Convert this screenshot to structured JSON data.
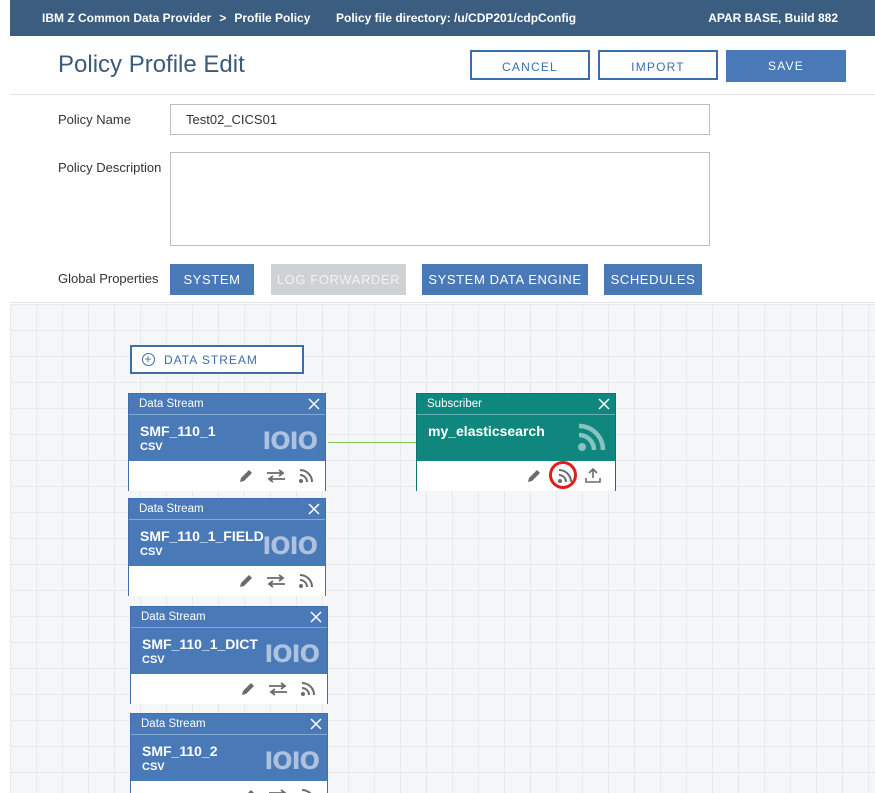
{
  "topbar": {
    "app_name": "IBM Z Common Data Provider",
    "separator": ">",
    "page": "Profile Policy",
    "policy_dir": "Policy file directory: /u/CDP201/cdpConfig",
    "build": "APAR BASE, Build 882"
  },
  "header": {
    "title": "Policy Profile Edit",
    "cancel_label": "CANCEL",
    "import_label": "IMPORT",
    "save_label": "SAVE"
  },
  "form": {
    "policy_name_label": "Policy Name",
    "policy_name_value": "Test02_CICS01",
    "policy_description_label": "Policy Description",
    "policy_description_value": "",
    "global_properties_label": "Global Properties"
  },
  "global_buttons": {
    "system": "SYSTEM",
    "log_forwarder": "LOG FORWARDER",
    "system_data_engine": "SYSTEM DATA ENGINE",
    "schedules": "SCHEDULES"
  },
  "canvas": {
    "add_stream_label": "DATA STREAM",
    "streams": [
      {
        "kind": "Data Stream",
        "name": "SMF_110_1",
        "format": "CSV"
      },
      {
        "kind": "Data Stream",
        "name": "SMF_110_1_FIELD",
        "format": "CSV"
      },
      {
        "kind": "Data Stream",
        "name": "SMF_110_1_DICT",
        "format": "CSV"
      },
      {
        "kind": "Data Stream",
        "name": "SMF_110_2",
        "format": "CSV"
      }
    ],
    "subscriber": {
      "kind": "Subscriber",
      "name": "my_elasticsearch"
    },
    "stream_icon_text": "IOIO"
  },
  "colors": {
    "topbar": "#3a5d80",
    "primary": "#4a79b8",
    "subscriber": "#0f877f",
    "connector": "#86c45a",
    "highlight": "#e21b1b"
  },
  "icons": [
    "close-icon",
    "edit-icon",
    "transform-icon",
    "subscribe-icon",
    "rss-icon",
    "upload-icon",
    "plus-circle-icon"
  ]
}
